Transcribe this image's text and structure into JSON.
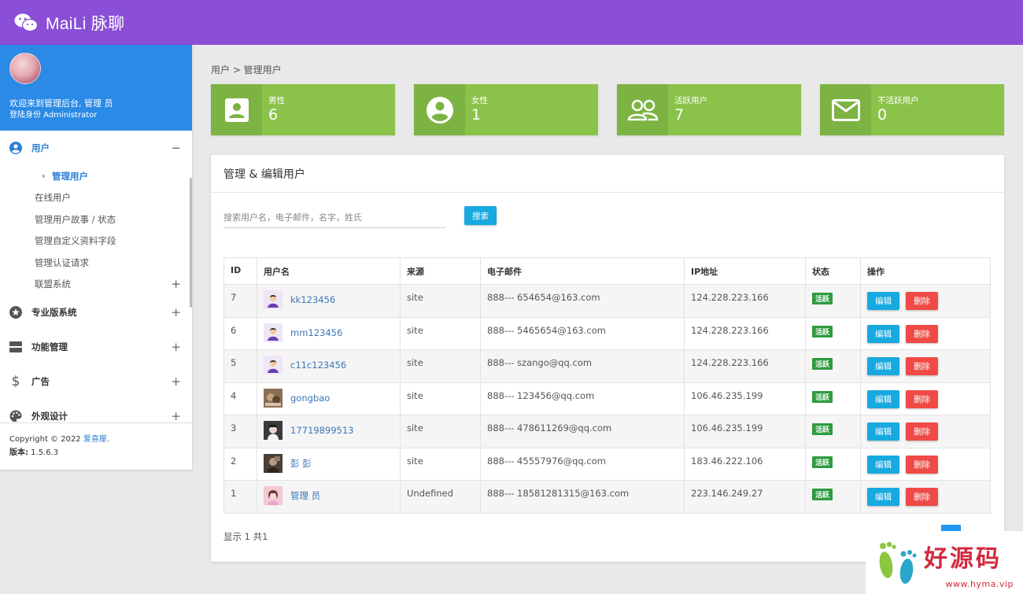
{
  "header": {
    "app_title": "MaiLi 脉聊",
    "logo_icon": "wechat-icon"
  },
  "sidebar": {
    "welcome": "欢迎来到管理后台, 管理 员",
    "role": "登陆身份 Administrator",
    "groups": [
      {
        "label": "用户",
        "icon": "user-circle-icon",
        "toggle": "−"
      },
      {
        "label": "专业版系统",
        "icon": "star-icon",
        "toggle": "+"
      },
      {
        "label": "功能管理",
        "icon": "server-icon",
        "toggle": "+"
      },
      {
        "label": "广告",
        "icon": "dollar-icon",
        "toggle": "+"
      },
      {
        "label": "外观设计",
        "icon": "palette-icon",
        "toggle": "+"
      }
    ],
    "user_items": [
      {
        "label": "管理用户"
      },
      {
        "label": "在线用户"
      },
      {
        "label": "管理用户故事 / 状态"
      },
      {
        "label": "管理自定义资料字段"
      },
      {
        "label": "管理认证请求"
      },
      {
        "label": "联盟系统",
        "toggle": "+"
      }
    ],
    "footer": {
      "copyright": "Copyright © 2022 ",
      "company": "爱喜屋",
      "dot": ".",
      "version_label": "版本:",
      "version": " 1.5.6.3"
    }
  },
  "breadcrumb": "用户 > 管理用户",
  "stats": [
    {
      "label": "男性",
      "value": "6",
      "icon": "person-box-icon"
    },
    {
      "label": "女性",
      "value": "1",
      "icon": "account-circle-icon"
    },
    {
      "label": "活跃用户",
      "value": "7",
      "icon": "people-icon"
    },
    {
      "label": "不活跃用户",
      "value": "0",
      "icon": "mail-icon"
    }
  ],
  "panel": {
    "title": "管理 & 编辑用户",
    "search_placeholder": "搜索用户名，电子邮件，名字，姓氏",
    "search_button": "搜索",
    "columns": [
      "ID",
      "用户名",
      "来源",
      "电子邮件",
      "IP地址",
      "状态",
      "操作"
    ],
    "rows": [
      {
        "id": "7",
        "username": "kk123456",
        "source": "site",
        "email": "888--- 654654@163.com",
        "ip": "124.228.223.166",
        "status": "活跃",
        "edit": "编辑",
        "delete": "删除"
      },
      {
        "id": "6",
        "username": "mm123456",
        "source": "site",
        "email": "888--- 5465654@163.com",
        "ip": "124.228.223.166",
        "status": "活跃",
        "edit": "编辑",
        "delete": "删除"
      },
      {
        "id": "5",
        "username": "c11c123456",
        "source": "site",
        "email": "888--- szango@qq.com",
        "ip": "124.228.223.166",
        "status": "活跃",
        "edit": "编辑",
        "delete": "删除"
      },
      {
        "id": "4",
        "username": "gongbao",
        "source": "site",
        "email": "888--- 123456@qq.com",
        "ip": "106.46.235.199",
        "status": "活跃",
        "edit": "编辑",
        "delete": "删除"
      },
      {
        "id": "3",
        "username": "17719899513",
        "source": "site",
        "email": "888--- 478611269@qq.com",
        "ip": "106.46.235.199",
        "status": "活跃",
        "edit": "编辑",
        "delete": "删除"
      },
      {
        "id": "2",
        "username": "彭 彭",
        "source": "site",
        "email": "888--- 45557976@qq.com",
        "ip": "183.46.222.106",
        "status": "活跃",
        "edit": "编辑",
        "delete": "删除"
      },
      {
        "id": "1",
        "username": "管理 员",
        "source": "Undefined",
        "email": "888--- 18581281315@163.com",
        "ip": "223.146.249.27",
        "status": "活跃",
        "edit": "编辑",
        "delete": "删除"
      }
    ],
    "footer_info": "显示 1 共1"
  },
  "watermark": {
    "text": "好源码",
    "sub": "www.hyma.vip"
  },
  "colors": {
    "topbar": "#8a4fd6",
    "profile": "#2a8ae5",
    "stat_card": "#8bc34a",
    "stat_icon_bg": "#7cb342",
    "edit": "#17a9e0",
    "delete": "#ef4a45",
    "badge": "#2e9b3f"
  }
}
